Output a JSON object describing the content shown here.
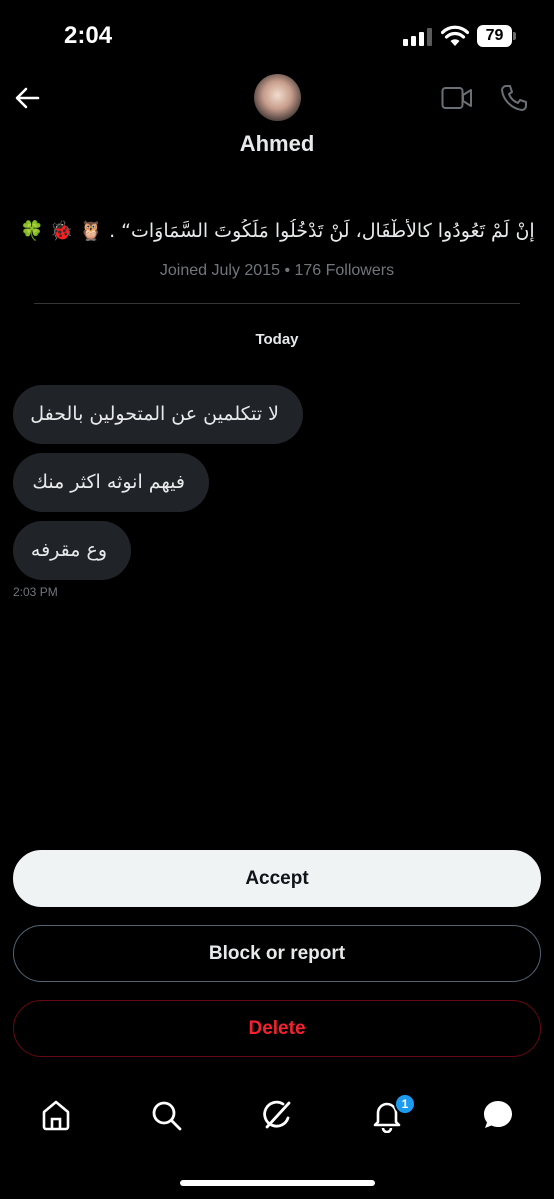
{
  "status_bar": {
    "time": "2:04",
    "battery": "79"
  },
  "header": {
    "profile_name": "Ahmed",
    "bio": "🍀 🐞 🦉 . “إِنْ لَمْ تَعُودُوا كالأَطْفَال، لَنْ تَدْخُلُوا مَلَكُوتَ السَّمَاوَات..”",
    "meta": "Joined July 2015 • 176 Followers"
  },
  "conversation": {
    "day_label": "Today",
    "messages": [
      {
        "text": "لا تتكلمين عن المتحولين بالحفل"
      },
      {
        "text": "فيهم انوثه اكثر منك"
      },
      {
        "text": "وع مقرفه"
      }
    ],
    "time": "2:03 PM"
  },
  "actions": {
    "accept": "Accept",
    "block": "Block or report",
    "delete": "Delete"
  },
  "nav": {
    "items": [
      "home-icon",
      "search-icon",
      "grok-icon",
      "notifications-icon",
      "messages-icon"
    ],
    "notification_badge": "1"
  },
  "colors": {
    "background": "#000000",
    "bubble": "#202327",
    "muted_text": "#71767b",
    "delete_red": "#f4212e",
    "badge_blue": "#1d9bf0"
  }
}
